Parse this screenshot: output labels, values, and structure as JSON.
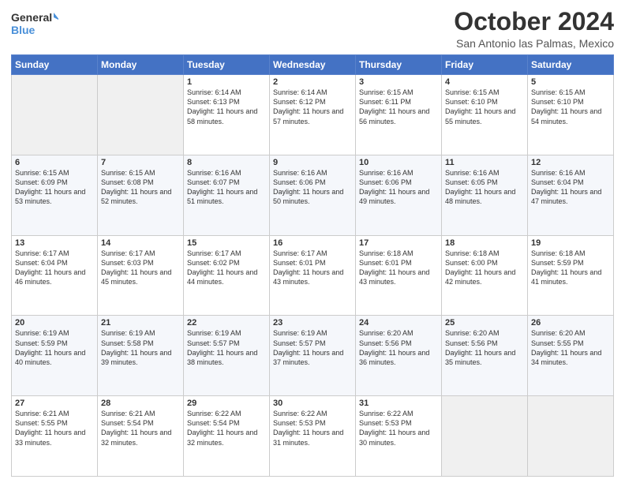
{
  "header": {
    "logo_line1": "General",
    "logo_line2": "Blue",
    "month": "October 2024",
    "location": "San Antonio las Palmas, Mexico"
  },
  "days_of_week": [
    "Sunday",
    "Monday",
    "Tuesday",
    "Wednesday",
    "Thursday",
    "Friday",
    "Saturday"
  ],
  "weeks": [
    [
      {
        "day": "",
        "empty": true
      },
      {
        "day": "",
        "empty": true
      },
      {
        "day": "1",
        "sunrise": "6:14 AM",
        "sunset": "6:13 PM",
        "daylight": "11 hours and 58 minutes."
      },
      {
        "day": "2",
        "sunrise": "6:14 AM",
        "sunset": "6:12 PM",
        "daylight": "11 hours and 57 minutes."
      },
      {
        "day": "3",
        "sunrise": "6:15 AM",
        "sunset": "6:11 PM",
        "daylight": "11 hours and 56 minutes."
      },
      {
        "day": "4",
        "sunrise": "6:15 AM",
        "sunset": "6:10 PM",
        "daylight": "11 hours and 55 minutes."
      },
      {
        "day": "5",
        "sunrise": "6:15 AM",
        "sunset": "6:10 PM",
        "daylight": "11 hours and 54 minutes."
      }
    ],
    [
      {
        "day": "6",
        "sunrise": "6:15 AM",
        "sunset": "6:09 PM",
        "daylight": "11 hours and 53 minutes."
      },
      {
        "day": "7",
        "sunrise": "6:15 AM",
        "sunset": "6:08 PM",
        "daylight": "11 hours and 52 minutes."
      },
      {
        "day": "8",
        "sunrise": "6:16 AM",
        "sunset": "6:07 PM",
        "daylight": "11 hours and 51 minutes."
      },
      {
        "day": "9",
        "sunrise": "6:16 AM",
        "sunset": "6:06 PM",
        "daylight": "11 hours and 50 minutes."
      },
      {
        "day": "10",
        "sunrise": "6:16 AM",
        "sunset": "6:06 PM",
        "daylight": "11 hours and 49 minutes."
      },
      {
        "day": "11",
        "sunrise": "6:16 AM",
        "sunset": "6:05 PM",
        "daylight": "11 hours and 48 minutes."
      },
      {
        "day": "12",
        "sunrise": "6:16 AM",
        "sunset": "6:04 PM",
        "daylight": "11 hours and 47 minutes."
      }
    ],
    [
      {
        "day": "13",
        "sunrise": "6:17 AM",
        "sunset": "6:04 PM",
        "daylight": "11 hours and 46 minutes."
      },
      {
        "day": "14",
        "sunrise": "6:17 AM",
        "sunset": "6:03 PM",
        "daylight": "11 hours and 45 minutes."
      },
      {
        "day": "15",
        "sunrise": "6:17 AM",
        "sunset": "6:02 PM",
        "daylight": "11 hours and 44 minutes."
      },
      {
        "day": "16",
        "sunrise": "6:17 AM",
        "sunset": "6:01 PM",
        "daylight": "11 hours and 43 minutes."
      },
      {
        "day": "17",
        "sunrise": "6:18 AM",
        "sunset": "6:01 PM",
        "daylight": "11 hours and 43 minutes."
      },
      {
        "day": "18",
        "sunrise": "6:18 AM",
        "sunset": "6:00 PM",
        "daylight": "11 hours and 42 minutes."
      },
      {
        "day": "19",
        "sunrise": "6:18 AM",
        "sunset": "5:59 PM",
        "daylight": "11 hours and 41 minutes."
      }
    ],
    [
      {
        "day": "20",
        "sunrise": "6:19 AM",
        "sunset": "5:59 PM",
        "daylight": "11 hours and 40 minutes."
      },
      {
        "day": "21",
        "sunrise": "6:19 AM",
        "sunset": "5:58 PM",
        "daylight": "11 hours and 39 minutes."
      },
      {
        "day": "22",
        "sunrise": "6:19 AM",
        "sunset": "5:57 PM",
        "daylight": "11 hours and 38 minutes."
      },
      {
        "day": "23",
        "sunrise": "6:19 AM",
        "sunset": "5:57 PM",
        "daylight": "11 hours and 37 minutes."
      },
      {
        "day": "24",
        "sunrise": "6:20 AM",
        "sunset": "5:56 PM",
        "daylight": "11 hours and 36 minutes."
      },
      {
        "day": "25",
        "sunrise": "6:20 AM",
        "sunset": "5:56 PM",
        "daylight": "11 hours and 35 minutes."
      },
      {
        "day": "26",
        "sunrise": "6:20 AM",
        "sunset": "5:55 PM",
        "daylight": "11 hours and 34 minutes."
      }
    ],
    [
      {
        "day": "27",
        "sunrise": "6:21 AM",
        "sunset": "5:55 PM",
        "daylight": "11 hours and 33 minutes."
      },
      {
        "day": "28",
        "sunrise": "6:21 AM",
        "sunset": "5:54 PM",
        "daylight": "11 hours and 32 minutes."
      },
      {
        "day": "29",
        "sunrise": "6:22 AM",
        "sunset": "5:54 PM",
        "daylight": "11 hours and 32 minutes."
      },
      {
        "day": "30",
        "sunrise": "6:22 AM",
        "sunset": "5:53 PM",
        "daylight": "11 hours and 31 minutes."
      },
      {
        "day": "31",
        "sunrise": "6:22 AM",
        "sunset": "5:53 PM",
        "daylight": "11 hours and 30 minutes."
      },
      {
        "day": "",
        "empty": true
      },
      {
        "day": "",
        "empty": true
      }
    ]
  ]
}
